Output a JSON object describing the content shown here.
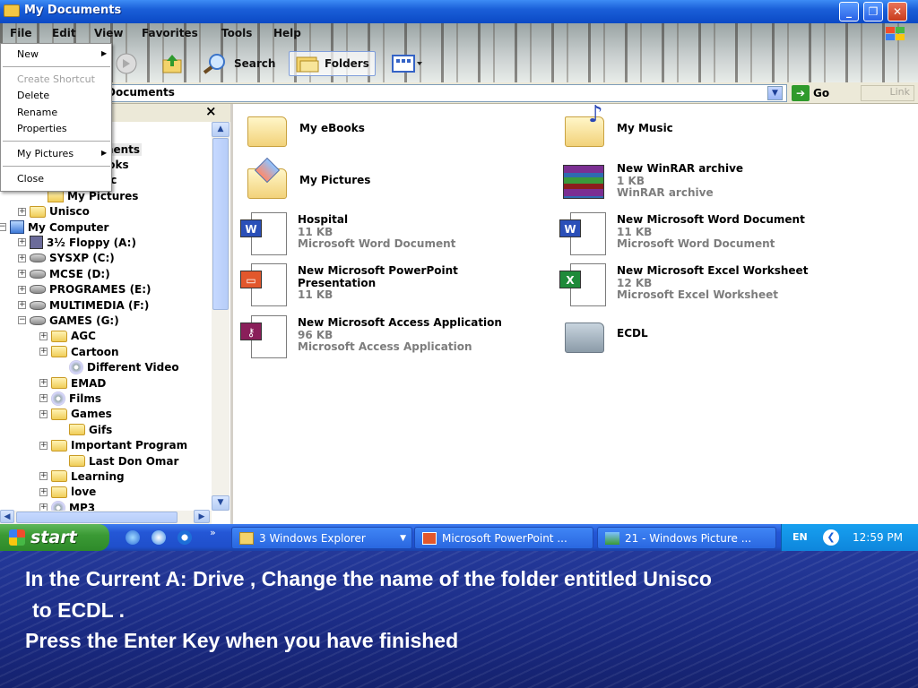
{
  "window": {
    "title": "My Documents",
    "controls": {
      "minimize": "_",
      "maximize": "❐",
      "close": "✕"
    }
  },
  "menubar": [
    "File",
    "Edit",
    "View",
    "Favorites",
    "Tools",
    "Help"
  ],
  "toolbar": {
    "search_label": "Search",
    "folders_label": "Folders"
  },
  "address": {
    "value": "Documents",
    "go_label": "Go",
    "extra": "Link"
  },
  "file_menu": {
    "new": "New",
    "create_shortcut": "Create Shortcut",
    "delete": "Delete",
    "rename": "Rename",
    "properties": "Properties",
    "my_pictures": "My Pictures",
    "close": "Close"
  },
  "tree": {
    "rows": [
      {
        "label": "ments",
        "expander": "",
        "icon": "folder"
      },
      {
        "label": "ooks",
        "expander": "",
        "icon": "folder"
      },
      {
        "label": "sic",
        "expander": "",
        "icon": "folder"
      },
      {
        "label": "My Pictures",
        "expander": "",
        "icon": "pictures"
      },
      {
        "label": "Unisco",
        "expander": "+",
        "icon": "folder"
      },
      {
        "label": "My Computer",
        "expander": "−",
        "icon": "computer"
      },
      {
        "label": "3½ Floppy (A:)",
        "expander": "+",
        "icon": "floppy"
      },
      {
        "label": "SYSXP (C:)",
        "expander": "+",
        "icon": "drive"
      },
      {
        "label": "MCSE (D:)",
        "expander": "+",
        "icon": "drive"
      },
      {
        "label": "PROGRAMES (E:)",
        "expander": "+",
        "icon": "drive"
      },
      {
        "label": "MULTIMEDIA (F:)",
        "expander": "+",
        "icon": "drive"
      },
      {
        "label": "GAMES (G:)",
        "expander": "−",
        "icon": "drive"
      },
      {
        "label": "AGC",
        "expander": "+",
        "icon": "folder"
      },
      {
        "label": "Cartoon",
        "expander": "+",
        "icon": "folder"
      },
      {
        "label": "Different Video",
        "expander": "",
        "icon": "cd"
      },
      {
        "label": "EMAD",
        "expander": "+",
        "icon": "folder"
      },
      {
        "label": "Films",
        "expander": "+",
        "icon": "cd"
      },
      {
        "label": "Games",
        "expander": "+",
        "icon": "folder"
      },
      {
        "label": "Gifs",
        "expander": "",
        "icon": "folder"
      },
      {
        "label": "Important Program",
        "expander": "+",
        "icon": "folder"
      },
      {
        "label": "Last Don Omar",
        "expander": "",
        "icon": "folder"
      },
      {
        "label": "Learning",
        "expander": "+",
        "icon": "folder"
      },
      {
        "label": "love",
        "expander": "+",
        "icon": "folder"
      },
      {
        "label": "MP3",
        "expander": "+",
        "icon": "cd"
      }
    ]
  },
  "files": {
    "ebooks": {
      "name": "My eBooks"
    },
    "music": {
      "name": "My Music"
    },
    "pictures": {
      "name": "My Pictures"
    },
    "winrar": {
      "name": "New WinRAR archive",
      "size": "1 KB",
      "type": "WinRAR archive"
    },
    "hospital": {
      "name": "Hospital",
      "size": "11 KB",
      "type": "Microsoft Word Document"
    },
    "word_new": {
      "name": "New Microsoft Word Document",
      "size": "11 KB",
      "type": "Microsoft Word Document"
    },
    "ppt": {
      "name1": "New Microsoft PowerPoint",
      "name2": "Presentation",
      "size": "11 KB"
    },
    "excel": {
      "name": "New Microsoft Excel Worksheet",
      "size": "12 KB",
      "type": "Microsoft Excel Worksheet"
    },
    "access": {
      "name": "New Microsoft Access Application",
      "size": "96 KB",
      "type": "Microsoft Access Application"
    },
    "ecdl": {
      "name": "ECDL"
    }
  },
  "taskbar": {
    "start": "start",
    "tasks": [
      "3 Windows Explorer",
      "Microsoft PowerPoint ...",
      "21 - Windows Picture ..."
    ],
    "lang": "EN",
    "clock": "12:59 PM"
  },
  "instruction": {
    "line1": "In the Current A: Drive , Change the name of the folder entitled Unisco",
    "line2": "to ECDL .",
    "line3": "Press the Enter Key when you have finished"
  },
  "colors": {
    "titlebar": "#0b49c5",
    "taskbar": "#2457d6",
    "start_green": "#3b9a35",
    "instruction_bg": "#1a2a82"
  }
}
